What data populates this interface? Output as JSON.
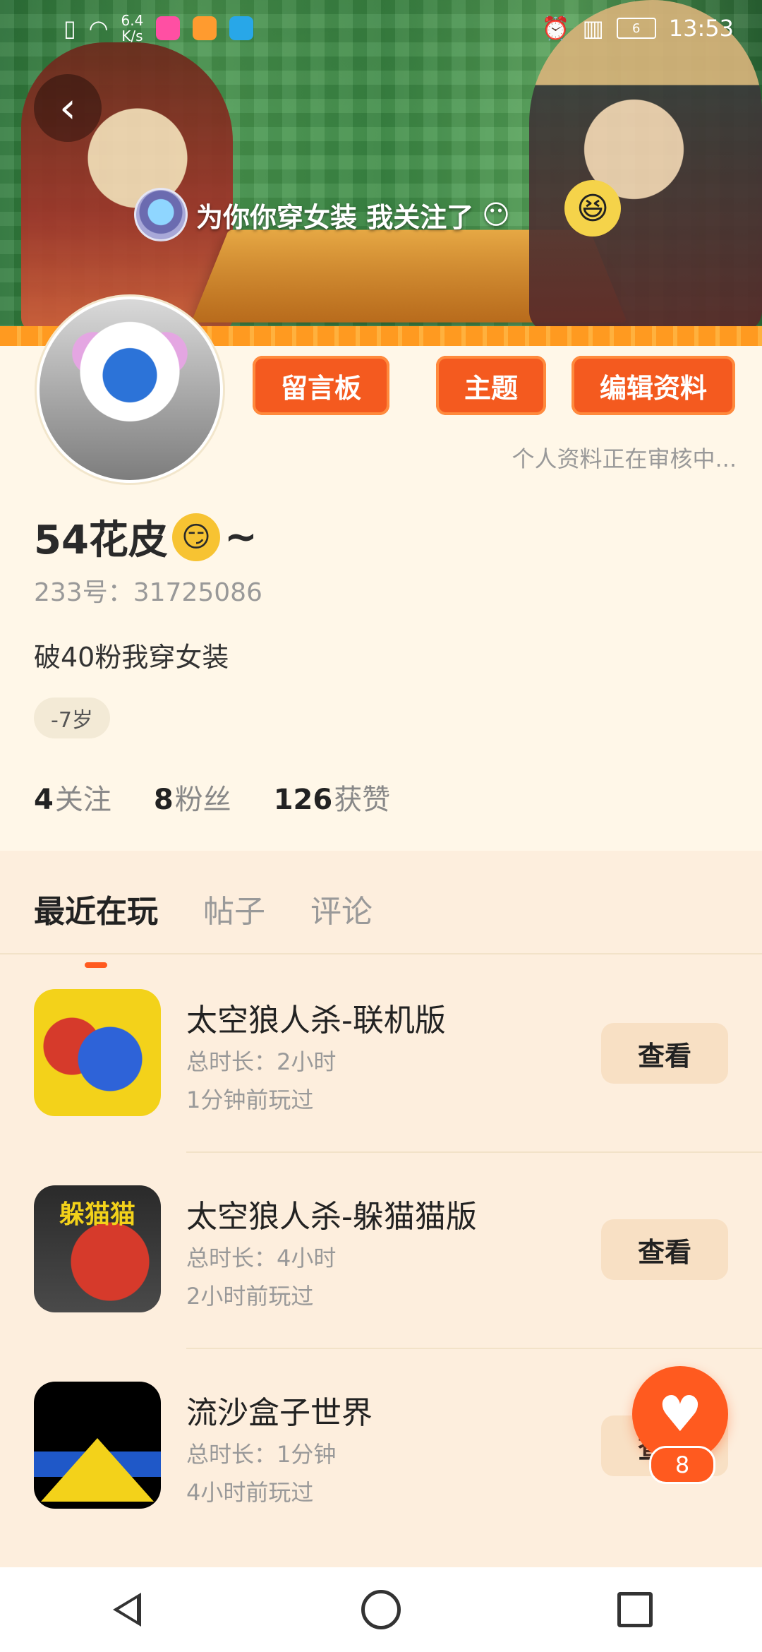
{
  "status_bar": {
    "net_speed_value": "6.4",
    "net_speed_unit": "K/s",
    "battery": "6",
    "time": "13:53"
  },
  "banner": {
    "follow_text": "为你你穿女装 我关注了",
    "follow_emoji": "😶"
  },
  "actions": {
    "message_board": "留言板",
    "theme": "主题",
    "edit_profile": "编辑资料",
    "review_note": "个人资料正在审核中..."
  },
  "profile": {
    "username": "54花皮",
    "username_emoji": "😏",
    "username_suffix": "~",
    "uid": "233号：31725086",
    "bio": "破40粉我穿女装",
    "age": "-7岁"
  },
  "stats": [
    {
      "num": "4",
      "label": "关注"
    },
    {
      "num": "8",
      "label": "粉丝"
    },
    {
      "num": "126",
      "label": "获赞"
    }
  ],
  "tabs": [
    "最近在玩",
    "帖子",
    "评论"
  ],
  "games": [
    {
      "title": "太空狼人杀-联机版",
      "duration": "总时长：2小时",
      "last_played": "1分钟前玩过",
      "button": "查看",
      "icon": "among-us-online-icon",
      "icon_label": ""
    },
    {
      "title": "太空狼人杀-躲猫猫版",
      "duration": "总时长：4小时",
      "last_played": "2小时前玩过",
      "button": "查看",
      "icon": "among-us-hide-seek-icon",
      "icon_label": "躲猫猫"
    },
    {
      "title": "流沙盒子世界",
      "duration": "总时长：1分钟",
      "last_played": "4小时前玩过",
      "button": "查看",
      "icon": "sandbox-world-icon",
      "icon_label": ""
    }
  ],
  "like": {
    "count": "8",
    "icon": "heart-icon"
  },
  "colors": {
    "accent": "#ff5a1f",
    "page_bg": "#fff7e8",
    "tab_area_bg": "#fdeedd"
  }
}
